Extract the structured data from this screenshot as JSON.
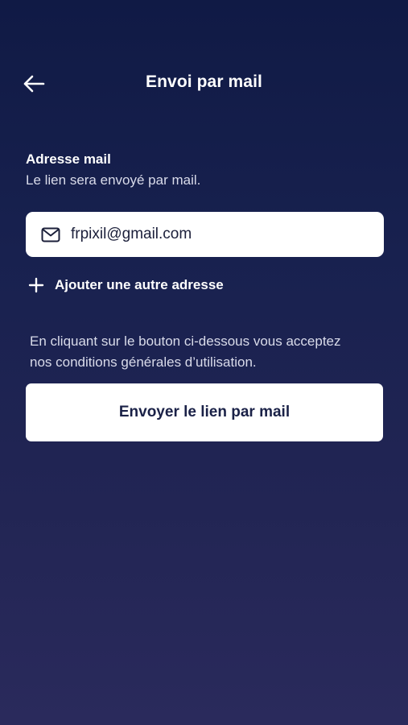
{
  "header": {
    "back_icon": "arrow-left-icon",
    "title": "Envoi par mail"
  },
  "email_section": {
    "label": "Adresse mail",
    "help": "Le lien sera envoyé par mail.",
    "field": {
      "icon": "mail-icon",
      "value": "frpixil@gmail.com"
    },
    "add_address": {
      "icon": "plus-icon",
      "label": "Ajouter une autre adresse"
    }
  },
  "terms": {
    "line1": "En cliquant sur le bouton ci-dessous vous acceptez",
    "line2": "nos conditions générales d’utilisation."
  },
  "send_button": {
    "label": "Envoyer le lien par mail"
  },
  "colors": {
    "background_top": "#101a45",
    "background_bottom": "#2a2a5c",
    "button_text": "#1a2147",
    "surface": "#ffffff"
  }
}
